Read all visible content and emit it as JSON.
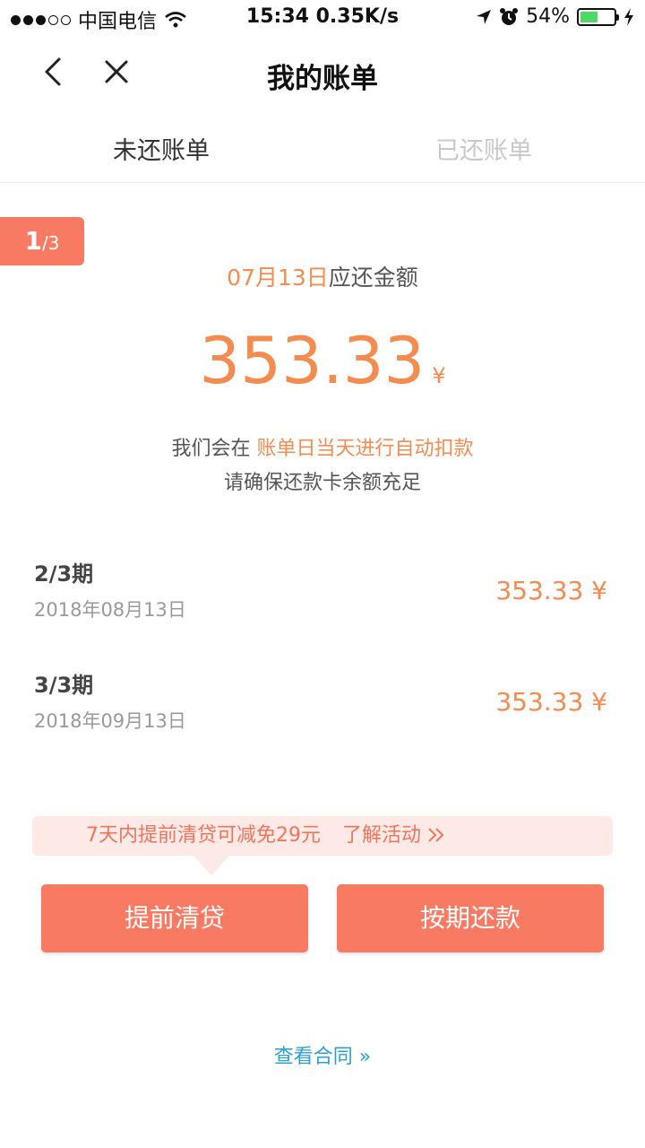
{
  "status_bar": {
    "carrier": "中国电信",
    "time_speed": "15:34 0.35K/s",
    "battery": "54%",
    "battery_level": 0.54,
    "battery_color": "#4cd964"
  },
  "nav": {
    "title": "我的账单"
  },
  "tabs": [
    {
      "label": "未还账单",
      "active": true
    },
    {
      "label": "已还账单",
      "active": false
    }
  ],
  "current_bill": {
    "period_current": "1",
    "period_total": "/3",
    "due_date": "07月13日",
    "due_label": "应还金额",
    "amount": "353.33",
    "currency": "¥",
    "note_prefix": "我们会在 ",
    "note_highlight": "账单日当天进行自动扣款",
    "note_line2": "请确保还款卡余额充足"
  },
  "installments": [
    {
      "period": "2/3期",
      "date": "2018年08月13日",
      "amount": "353.33 ¥"
    },
    {
      "period": "3/3期",
      "date": "2018年09月13日",
      "amount": "353.33 ¥"
    }
  ],
  "promo": {
    "text": "7天内提前清贷可减免29元",
    "link": "了解活动"
  },
  "buttons": {
    "prepay": "提前清贷",
    "repay": "按期还款"
  },
  "contract_link": "查看合同 »",
  "colors": {
    "accent": "#f87a63",
    "amount": "#f48b4f",
    "link": "#2aa0d8"
  }
}
